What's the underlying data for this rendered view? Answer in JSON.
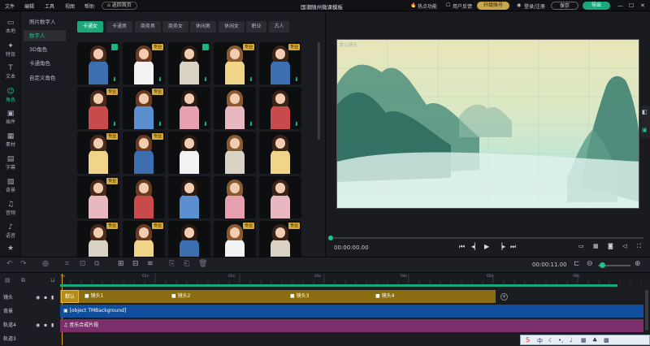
{
  "menu": [
    "文件",
    "编辑",
    "工具",
    "视图",
    "帮助"
  ],
  "home_label": "返回首页",
  "app_title": "国潮随州微课模板",
  "hot_label": "热点功能",
  "feedback_label": "用户反馈",
  "upgrade_label": "升级账号",
  "login_label": "登录/注册",
  "save_label": "保存",
  "export_label": "导出",
  "nav": [
    {
      "label": "本地",
      "icon": "folder-icon"
    },
    {
      "label": "特效",
      "icon": "sparkle-icon"
    },
    {
      "label": "文本",
      "icon": "text-icon"
    },
    {
      "label": "角色",
      "icon": "person-icon"
    },
    {
      "label": "插件",
      "icon": "plugin-icon"
    },
    {
      "label": "素材",
      "icon": "material-icon"
    },
    {
      "label": "字幕",
      "icon": "subtitle-icon"
    },
    {
      "label": "背景",
      "icon": "background-icon"
    },
    {
      "label": "音频",
      "icon": "music-icon"
    },
    {
      "label": "语音",
      "icon": "voice-icon"
    },
    {
      "label": "",
      "icon": "star-icon"
    }
  ],
  "subcats": [
    "照片数字人",
    "数字人",
    "3D角色",
    "卡通角色",
    "自定义角色"
  ],
  "tabs": [
    "卡通女",
    "卡通男",
    "商务男",
    "商务女",
    "休闲男",
    "休闲女",
    "职业",
    "古人"
  ],
  "pro_badge": "专业",
  "preview": {
    "lens_label": "默认镜头",
    "time": "00:00:00.00"
  },
  "timeline": {
    "time": "00:00:11.00",
    "ruler": [
      "0s",
      "01s",
      "02s",
      "03s",
      "04s",
      "05s",
      "06s"
    ],
    "tracks": [
      {
        "label": "镜头"
      },
      {
        "label": "背景"
      },
      {
        "label": "轨道4"
      },
      {
        "label": "轨道3"
      }
    ],
    "lens_clips": [
      "默认",
      "镜头1",
      "镜头2",
      "镜头3",
      "镜头4"
    ],
    "bg_clip": "[object TMBackground]",
    "audio_clip": "音乐合成片段"
  },
  "colors": {
    "accent": "#1ec48e",
    "lens_track": "#8a6d10",
    "bg_track": "#0e4e9c",
    "audio_track": "#7a2f6a"
  }
}
